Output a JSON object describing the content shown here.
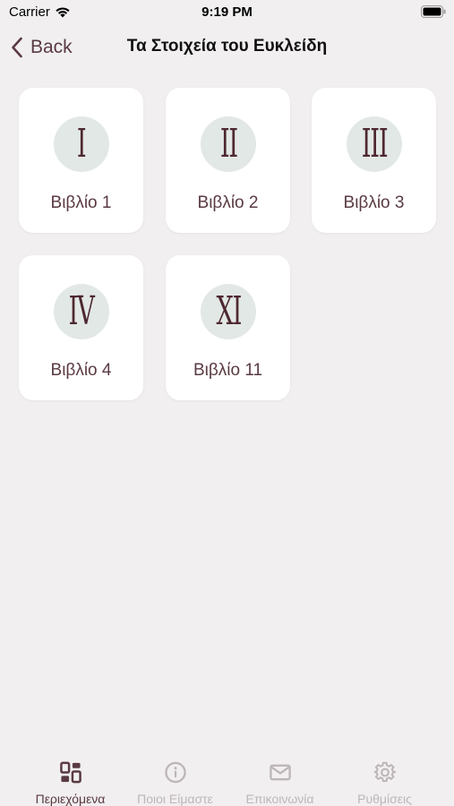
{
  "status_bar": {
    "carrier": "Carrier",
    "time": "9:19 PM"
  },
  "nav": {
    "back_label": "Back",
    "title": "Τα Στοιχεία του Ευκλείδη"
  },
  "books": [
    {
      "numeral": "I",
      "label": "Βιβλίο 1"
    },
    {
      "numeral": "II",
      "label": "Βιβλίο 2"
    },
    {
      "numeral": "III",
      "label": "Βιβλίο 3"
    },
    {
      "numeral": "IV",
      "label": "Βιβλίο 4"
    },
    {
      "numeral": "XI",
      "label": "Βιβλίο 11"
    }
  ],
  "tabs": [
    {
      "label": "Περιεχόμενα",
      "icon": "contents-grid-icon",
      "active": true
    },
    {
      "label": "Ποιοι Είμαστε",
      "icon": "info-circle-icon",
      "active": false
    },
    {
      "label": "Επικοινωνία",
      "icon": "envelope-icon",
      "active": false
    },
    {
      "label": "Ρυθμίσεις",
      "icon": "gear-icon",
      "active": false
    }
  ],
  "colors": {
    "accent": "#5a3a42",
    "background": "#f1eff0",
    "card": "#ffffff",
    "medallion": "#e2e8e6",
    "tab_inactive": "#bdb6b8"
  }
}
